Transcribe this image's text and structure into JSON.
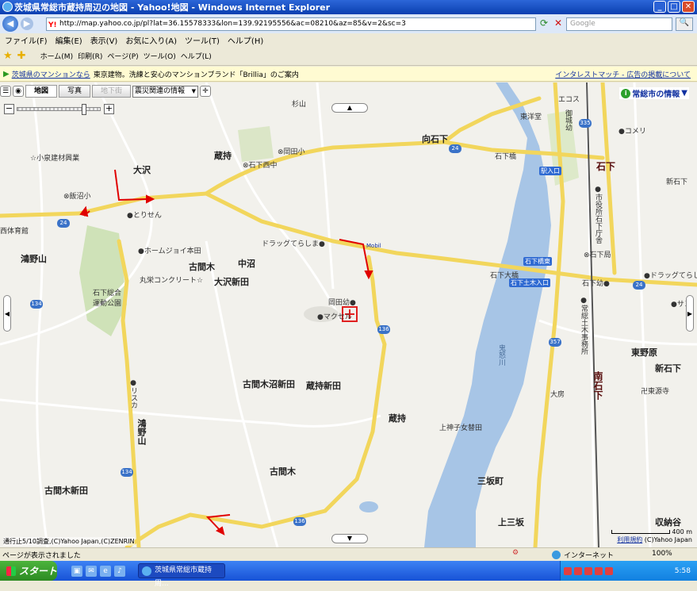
{
  "window": {
    "title": "茨城県常総市蔵持周辺の地図 - Yahoo!地図 - Windows Internet Explorer",
    "url": "http://map.yahoo.co.jp/pl?lat=36.15578333&lon=139.92195556&ac=08210&az=85&v=2&sc=3",
    "search_placeholder": "Google"
  },
  "menu": [
    "ファイル(F)",
    "編集(E)",
    "表示(V)",
    "お気に入り(A)",
    "ツール(T)",
    "ヘルプ(H)"
  ],
  "toolbar": {
    "home": "ホーム(M)",
    "print": "印刷(R)",
    "page": "ページ(P)",
    "tools": "ツール(O)",
    "help": "ヘルプ(L)"
  },
  "ad": {
    "link": "茨城県のマンションなら",
    "text": "東京建物。洗練と安心のマンションブランド「Brillia」のご案内",
    "right": "インタレストマッチ - 広告の掲載について"
  },
  "map": {
    "tabs": [
      "地図",
      "写真",
      "地下街"
    ],
    "select": "震災関連の情報",
    "city_info": "常総市の情報",
    "copyright": "通行止5/10調査,(C)Yahoo Japan,(C)ZENRIN",
    "scale_label": "400 m",
    "terms": "利用規約",
    "terms_copy": "(C)Yahoo Japan",
    "labels": {
      "sugiyama": "杉山",
      "ecos": "エコス",
      "higashiyo": "東洋堂",
      "gosaidou": "御城幼",
      "komeri": "●コメリ",
      "koizumi": "☆小泉建材興業",
      "osawa": "大沢",
      "kuramochi": "蔵持",
      "okadasho": "⊗岡田小",
      "ishigenishi": "⊗石下西中",
      "mukouishige": "向石下",
      "ishigebashi": "石下橋",
      "ishige_station": "石下",
      "iriguchi": "駅入口",
      "niishige": "新石下",
      "shiyakusho": "●市役所石下庁舎",
      "iinuma": "⊗飯沼小",
      "torisen": "●とりせん",
      "nishitaiiku": "西体育館",
      "drug1": "ドラッグてらしま●",
      "mobil": "Mobil",
      "kamiyama": "鴻野山",
      "homejoi": "●ホームジョイ本田",
      "furumaki": "古間木",
      "nakanuma": "中沼",
      "maruei": "丸栄コンクリート☆",
      "osawashinden": "大沢新田",
      "park": "石下総合運動公園",
      "okadayo": "岡田幼●",
      "makuseru": "●マクセル",
      "ishigeohashi": "石下大橋",
      "ishigehigashi": "石下橋東",
      "ishigedobokuiriguchi": "石下土木入口",
      "ishigekyoku": "⊗石下局",
      "ishigeyo": "石下幼●",
      "drug2": "●ドラッグてらしま",
      "sun": "●サン",
      "joso_doboku": "●常総土木事務所",
      "kinugawa": "鬼怒川",
      "higashinohara": "東野原",
      "minamiishige_other": "新石下",
      "ohusa": "大房",
      "minamiishige_station": "南石下",
      "tougenji": "卍東源寺",
      "risuka": "●リスカ",
      "furumakinumashinden": "古間木沼新田",
      "kuramochishinden": "蔵持新田",
      "kuramochi2": "蔵持",
      "kamijo": "上神子女替田",
      "konoyama2": "鴻野山",
      "sanhachou": "三坂町",
      "furumakishinden": "古間木新田",
      "furumaki2": "古間木",
      "kamisanzaka": "上三坂",
      "shuuden": "収納谷"
    },
    "routes": [
      "24",
      "24",
      "24",
      "335",
      "134",
      "357",
      "136",
      "134",
      "136"
    ]
  },
  "status": {
    "text": "ページが表示されました",
    "zone": "インターネット",
    "zoom": "100%"
  },
  "taskbar": {
    "start": "スタート",
    "task": "茨城県常総市蔵持周...",
    "clock": "5:58"
  }
}
